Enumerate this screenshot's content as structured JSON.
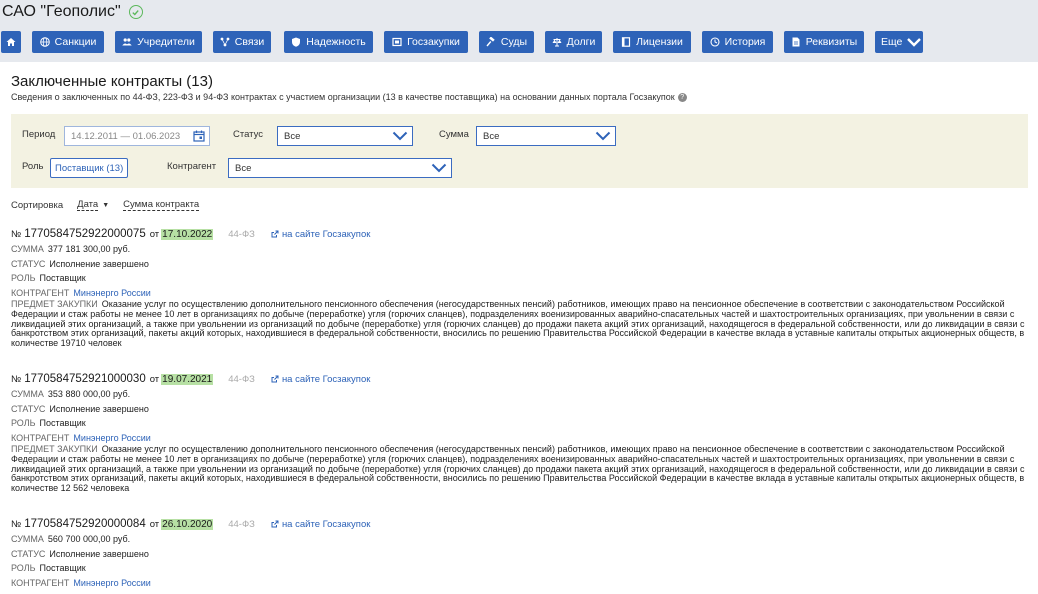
{
  "company": {
    "name": "САО \"Геополис\"",
    "verified_icon": "check-circle-icon"
  },
  "nav": [
    {
      "id": "home",
      "label": "",
      "icon": "home-icon"
    },
    {
      "id": "sanctions",
      "label": "Санкции",
      "icon": "globe-icon"
    },
    {
      "id": "founders",
      "label": "Учредители",
      "icon": "users-icon"
    },
    {
      "id": "links",
      "label": "Связи",
      "icon": "network-icon"
    },
    {
      "id": "reliability",
      "label": "Надежность",
      "icon": "shield-icon"
    },
    {
      "id": "procurement",
      "label": "Госзакупки",
      "icon": "procurement-icon"
    },
    {
      "id": "courts",
      "label": "Суды",
      "icon": "gavel-icon"
    },
    {
      "id": "debts",
      "label": "Долги",
      "icon": "scales-icon"
    },
    {
      "id": "licenses",
      "label": "Лицензии",
      "icon": "license-icon"
    },
    {
      "id": "history",
      "label": "История",
      "icon": "history-icon"
    },
    {
      "id": "requisites",
      "label": "Реквизиты",
      "icon": "document-icon"
    },
    {
      "id": "more",
      "label": "Еще",
      "icon": "chevron-down-icon"
    }
  ],
  "section": {
    "title": "Заключенные контракты (13)",
    "subtitle": "Сведения о заключенных по 44-ФЗ, 223-ФЗ и 94-ФЗ контрактах с участием организации (13 в качестве поставщика) на основании данных портала Госзакупок",
    "help_icon": "?"
  },
  "filters": {
    "period_label": "Период",
    "period_value": "14.12.2011 — 01.06.2023",
    "status_label": "Статус",
    "status_value": "Все",
    "sum_label": "Сумма",
    "sum_value": "Все",
    "role_label": "Роль",
    "role_value": "Поставщик (13)",
    "counterparty_label": "Контрагент",
    "counterparty_value": "Все"
  },
  "sort": {
    "label": "Сортировка",
    "date": "Дата",
    "sum": "Сумма контракта"
  },
  "labels": {
    "number_prefix": "№",
    "from": "от",
    "sum": "СУММА",
    "status": "СТАТУС",
    "role": "РОЛЬ",
    "counterparty": "КОНТРАГЕНТ",
    "subject": "ПРЕДМЕТ ЗАКУПКИ",
    "gov_link": "на сайте Госзакупок"
  },
  "contracts": [
    {
      "number": "1770584752922000075",
      "date": "17.10.2022",
      "law": "44-ФЗ",
      "sum": "377 181 300,00 руб.",
      "status": "Исполнение завершено",
      "role": "Поставщик",
      "counterparty": "Минэнерго России",
      "subject": "Оказание услуг по осуществлению дополнительного пенсионного обеспечения (негосударственных пенсий) работников, имеющих право на пенсионное обеспечение в соответствии с законодательством Российской Федерации и стаж работы не менее 10 лет в организациях по добыче (переработке) угля (горючих сланцев), подразделениях военизированных аварийно-спасательных частей и шахтостроительных организациях, при увольнении в связи с ликвидацией этих организаций, а также при увольнении из организаций по добыче (переработке) угля (горючих сланцев) до продажи пакета акций этих организаций, находящегося в федеральной собственности, или до ликвидации в связи с банкротством этих организаций, пакеты акций которых, находившиеся в федеральной собственности, вносились по решению Правительства Российской Федерации в качестве вклада в уставные капиталы открытых акционерных обществ, в количестве 19710 человек"
    },
    {
      "number": "1770584752921000030",
      "date": "19.07.2021",
      "law": "44-ФЗ",
      "sum": "353 880 000,00 руб.",
      "status": "Исполнение завершено",
      "role": "Поставщик",
      "counterparty": "Минэнерго России",
      "subject": "Оказание услуг по осуществлению дополнительного пенсионного обеспечения (негосударственных пенсий) работников, имеющих право на пенсионное обеспечение в соответствии с законодательством Российской Федерации и стаж работы не менее 10 лет в организациях по добыче (переработке) угля (горючих сланцев), подразделениях военизированных аварийно-спасательных частей и шахтостроительных организациях, при увольнении в связи с ликвидацией этих организаций, а также при увольнении из организаций по добыче (переработке) угля (горючих сланцев) до продажи пакета акций этих организаций, находящегося в федеральной собственности, или до ликвидации в связи с банкротством этих организаций, пакеты акций которых, находившиеся в федеральной собственности, вносились по решению Правительства Российской Федерации в качестве вклада в уставные капиталы открытых акционерных обществ, в количестве 12 562 человека"
    },
    {
      "number": "1770584752920000084",
      "date": "26.10.2020",
      "law": "44-ФЗ",
      "sum": "560 700 000,00 руб.",
      "status": "Исполнение завершено",
      "role": "Поставщик",
      "counterparty": "Минэнерго России",
      "subject": ""
    }
  ]
}
